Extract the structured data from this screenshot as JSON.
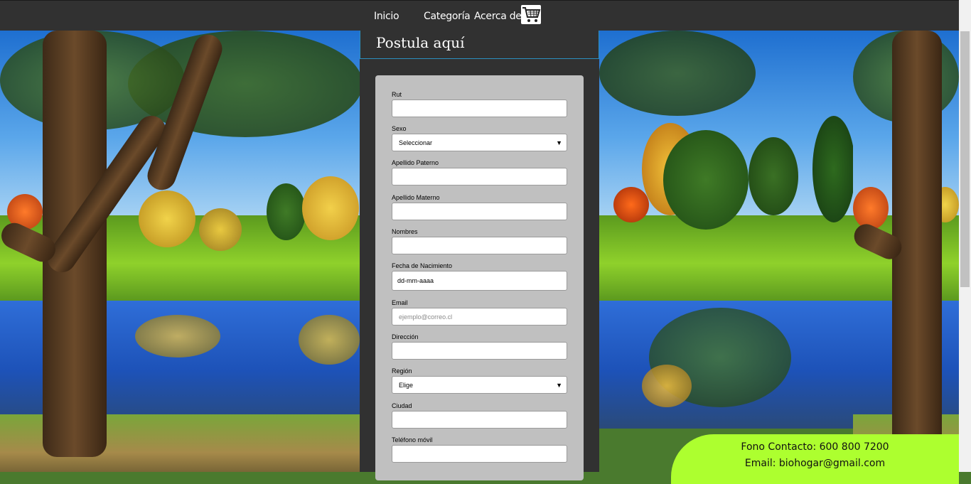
{
  "nav": {
    "items": [
      "Inicio",
      "Categoría",
      "Acerca de"
    ],
    "cart_icon": "shopping-cart-icon"
  },
  "page": {
    "title": "Postula aquí"
  },
  "form": {
    "fields": [
      {
        "label": "Rut",
        "type": "text",
        "value": ""
      },
      {
        "label": "Sexo",
        "type": "select",
        "value": "Seleccionar"
      },
      {
        "label": "Apellido Paterno",
        "type": "text",
        "value": ""
      },
      {
        "label": "Apellido Materno",
        "type": "text",
        "value": ""
      },
      {
        "label": "Nombres",
        "type": "text",
        "value": ""
      },
      {
        "label": "Fecha de Nacimiento",
        "type": "date",
        "value": "dd-mm-aaaa"
      },
      {
        "label": "Email",
        "type": "email",
        "placeholder": "ejemplo@correo.cl"
      },
      {
        "label": "Dirección",
        "type": "text",
        "value": ""
      },
      {
        "label": "Región",
        "type": "select",
        "value": "Elige"
      },
      {
        "label": "Ciudad",
        "type": "text",
        "value": ""
      },
      {
        "label": "Teléfono móvil",
        "type": "text",
        "value": ""
      }
    ]
  },
  "footer": {
    "phone": "Fono Contacto: 600 800 7200",
    "email": "Email: biohogar@gmail.com"
  },
  "colors": {
    "nav_bg": "#313131",
    "form_bg": "#c0c0c0",
    "footer_bg": "#adff2f",
    "title_border": "#2b8fbf"
  }
}
